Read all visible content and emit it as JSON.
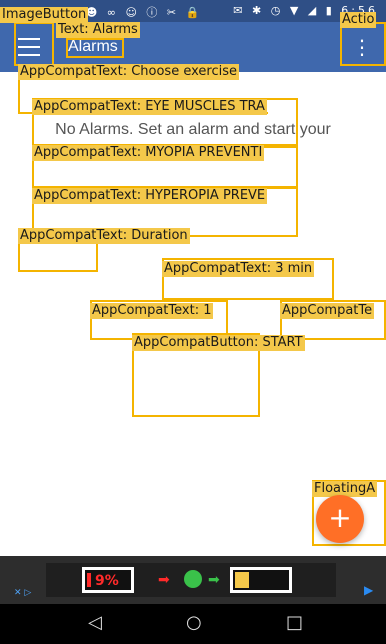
{
  "status_bar": {
    "left_icons": "▣ ◧ ◔ ☻ ☻ ∞ ☺ ⓘ ✂ 🔒",
    "right_icons": "✉ ✱ ◷ ▼ ◢ ▮",
    "time": "6:56"
  },
  "app_bar": {
    "title": "Alarms",
    "menu_icon": "hamburger-icon",
    "overflow_icon": "more-vert-icon",
    "overflow_glyph": "⋮"
  },
  "main": {
    "empty_message": "No Alarms. Set an alarm and start your"
  },
  "overlay_labels": {
    "image_button": "ImageButton",
    "text_alarms": "Text: Alarms",
    "action": "Actio",
    "choose_exercise": "AppCompatText: Choose exercise",
    "eye_muscles": "AppCompatText: EYE MUSCLES TRA",
    "myopia": "AppCompatText: MYOPIA PREVENTI",
    "hyperopia": "AppCompatText: HYPEROPIA PREVE",
    "duration": "AppCompatText: Duration",
    "three_min": "AppCompatText: 3 min",
    "one": "AppCompatText: 1",
    "appcompat_te": "AppCompatTe",
    "start_button": "AppCompatButton: START",
    "floating": "FloatingA"
  },
  "fab": {
    "glyph": "+"
  },
  "ad": {
    "battery_percent": "9%",
    "arrow": "➡",
    "adchoices": "✕ ▷"
  },
  "nav": {
    "back": "◁",
    "home": "○",
    "recents": "□"
  },
  "colors": {
    "app_bar": "#3f68ad",
    "status_bar": "#2f4f86",
    "fab": "#ff6f26",
    "overlay": "#f4b400"
  }
}
